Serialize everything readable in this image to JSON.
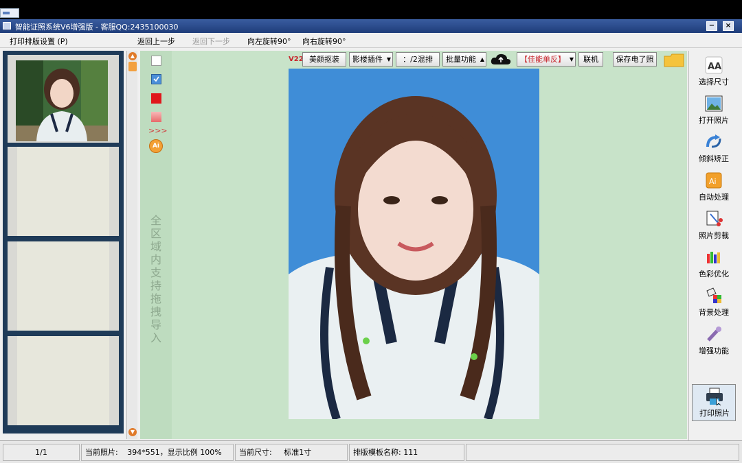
{
  "window": {
    "title": "智能证照系统V6增强版 - 客服QQ:2435100030",
    "minimize": "−",
    "close": "×"
  },
  "menu": {
    "print_layout": "打印排版设置 (P)",
    "undo": "返回上一步",
    "redo": "返回下一步",
    "rotate_left": "向左旋转90°",
    "rotate_right": "向右旋转90°"
  },
  "toolbar": {
    "version": "V22",
    "beauty": "美颜抠装",
    "plugin": "影楼插件",
    "layout": "：/2混排",
    "batch": "批量功能",
    "camera_select": "【佳能单反】",
    "connect": "联机",
    "save_photo": "保存电了照"
  },
  "tool_strip": {
    "drop_hint": "全区域内支持拖拽导入",
    "colors": {
      "white": "#ffffff",
      "blue": "#4b8fd9",
      "red": "#e0161b",
      "pink": "#f08c8c"
    },
    "more": ">>>"
  },
  "right_panel": [
    {
      "label": "选择尺寸",
      "icon": "font-size-icon"
    },
    {
      "label": "打开照片",
      "icon": "open-photo-icon"
    },
    {
      "label": "倾斜矫正",
      "icon": "tilt-correct-icon"
    },
    {
      "label": "自动处理",
      "icon": "auto-process-icon"
    },
    {
      "label": "照片剪裁",
      "icon": "crop-icon"
    },
    {
      "label": "色彩优化",
      "icon": "color-optimize-icon"
    },
    {
      "label": "背景处理",
      "icon": "background-icon"
    },
    {
      "label": "增强功能",
      "icon": "enhance-icon"
    },
    {
      "label": "打印照片",
      "icon": "printer-icon"
    }
  ],
  "status": {
    "page": "1/1",
    "current_photo_label": "当前照片:",
    "current_photo_value": "394*551，显示比例 100%",
    "current_size_label": "当前尺寸:",
    "current_size_value": "标准1寸",
    "template_label": "排版模板名称:",
    "template_value": "111"
  },
  "colors": {
    "photo_background": "#3f8dd7",
    "canvas": "#c8e3c9",
    "left_panel": "#1f3b58"
  }
}
